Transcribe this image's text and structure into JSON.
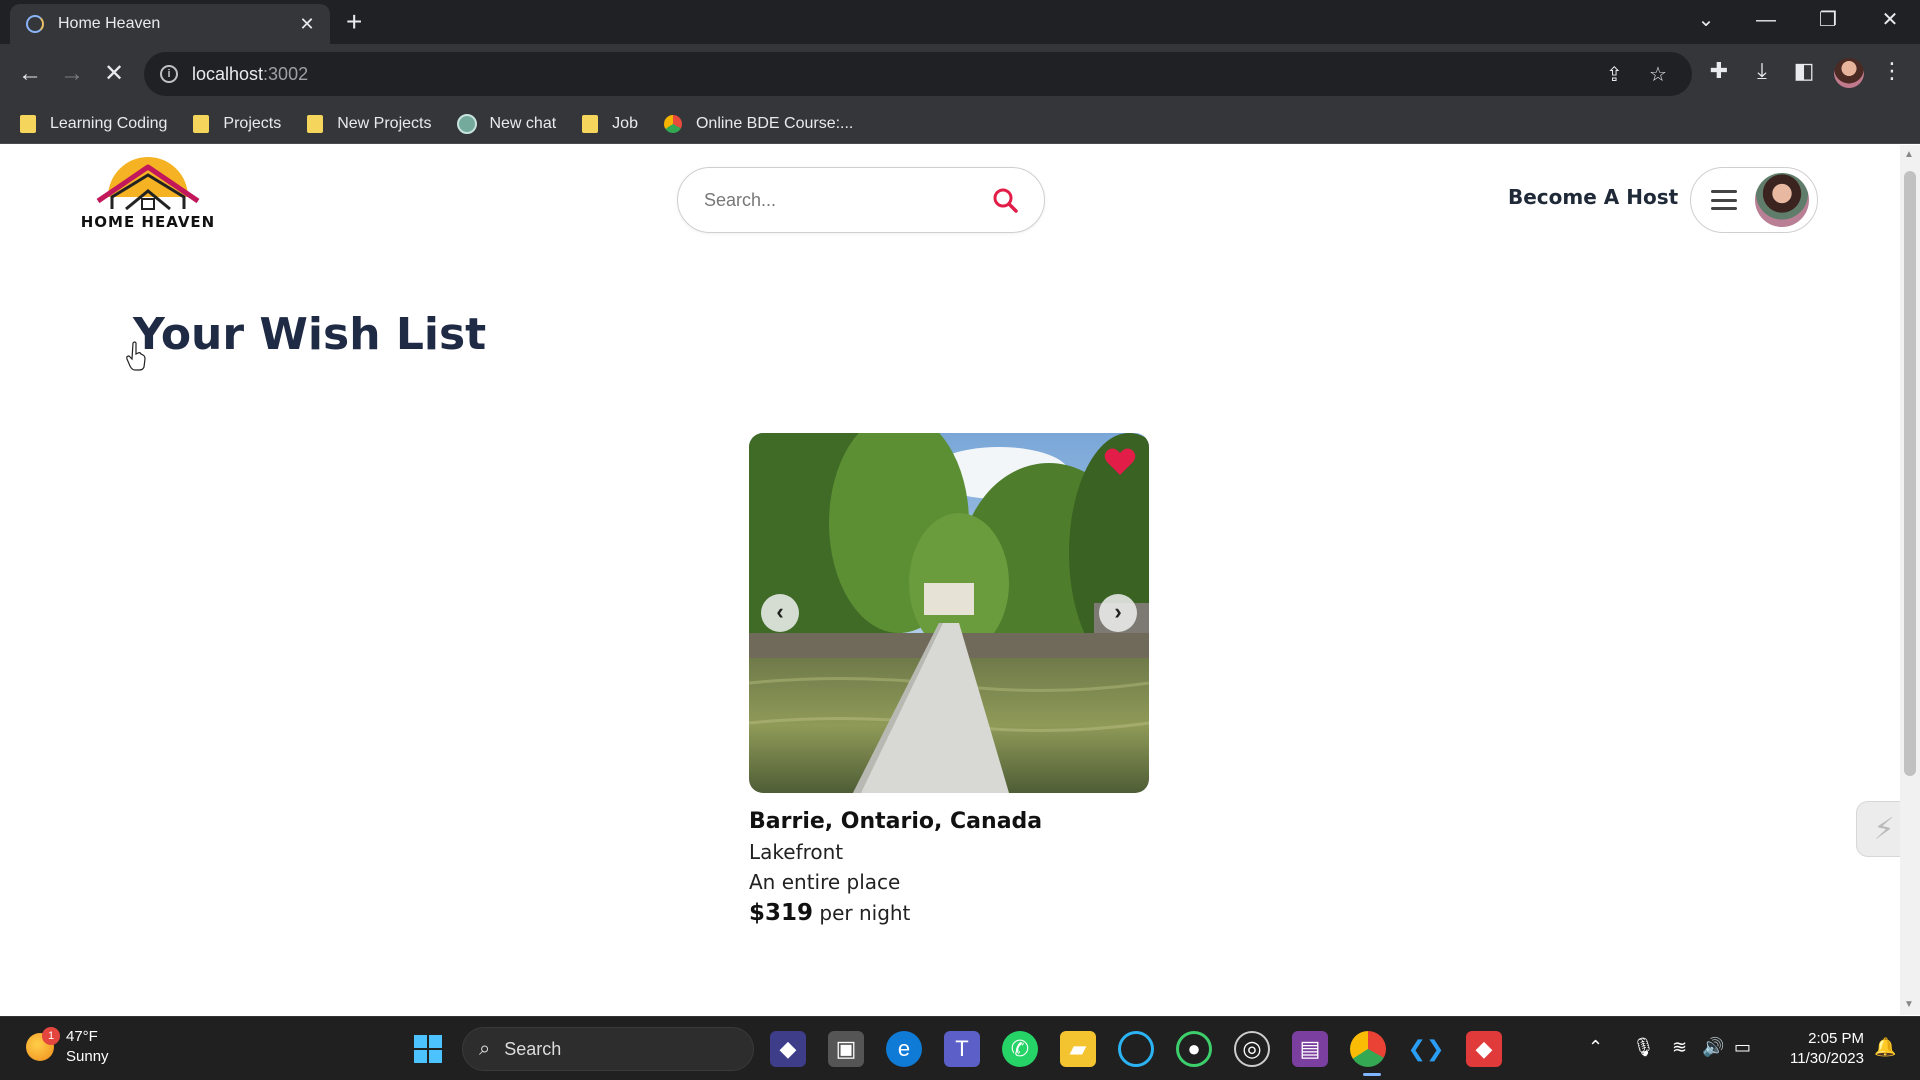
{
  "browser": {
    "tab_title": "Home Heaven",
    "url_host": "localhost",
    "url_port": ":3002",
    "bookmarks": [
      {
        "label": "Learning Coding",
        "icon": "folder-icon"
      },
      {
        "label": "Projects",
        "icon": "folder-icon"
      },
      {
        "label": "New Projects",
        "icon": "folder-icon"
      },
      {
        "label": "New chat",
        "icon": "chatgpt-icon"
      },
      {
        "label": "Job",
        "icon": "folder-icon"
      },
      {
        "label": "Online BDE Course:...",
        "icon": "course-icon"
      }
    ]
  },
  "header": {
    "logo_text": "HOME HEAVEN",
    "search_placeholder": "Search...",
    "host_link": "Become A Host"
  },
  "page": {
    "title": "Your Wish List"
  },
  "listing": {
    "location": "Barrie, Ontario, Canada",
    "category": "Lakefront",
    "type": "An entire place",
    "price": "$319",
    "price_suffix": "per night",
    "favorited": true
  },
  "taskbar": {
    "weather_temp": "47°F",
    "weather_desc": "Sunny",
    "weather_badge": "1",
    "search_label": "Search",
    "time": "2:05 PM",
    "date": "11/30/2023"
  },
  "colors": {
    "accent_red": "#e11d48",
    "title_navy": "#1f2a44",
    "chrome_dark": "#202124"
  }
}
